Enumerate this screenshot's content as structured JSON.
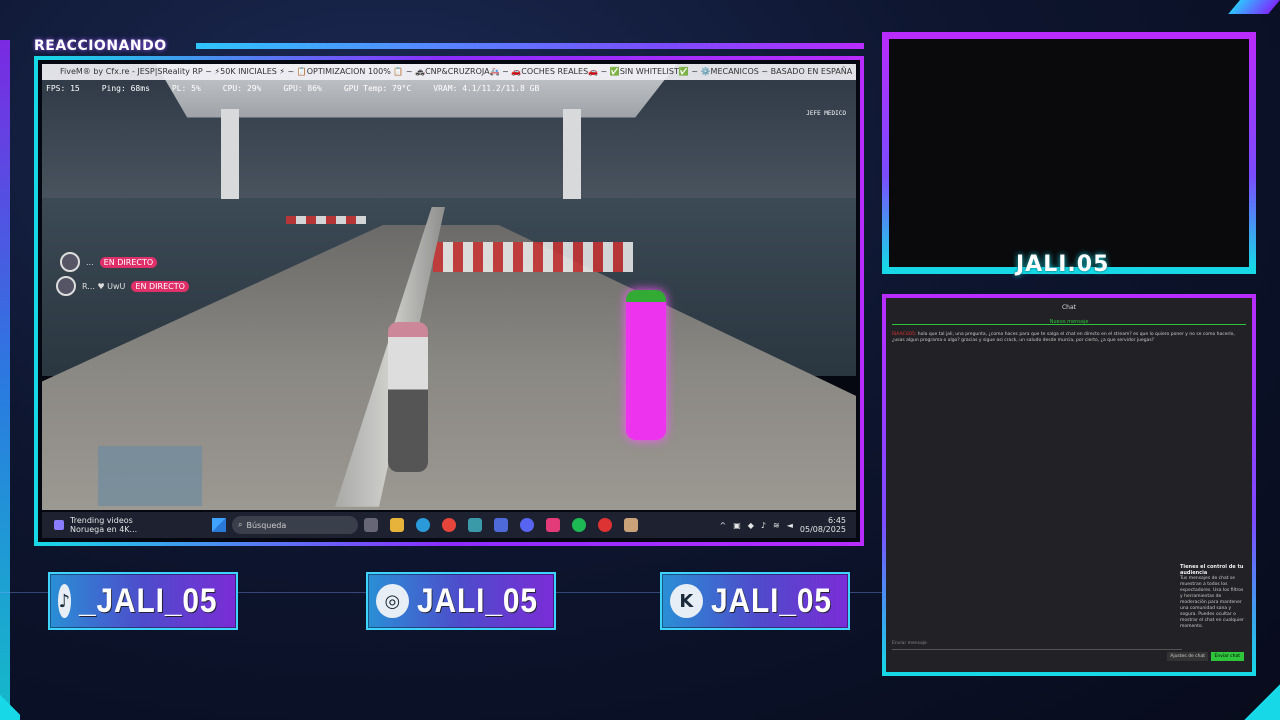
{
  "overlay": {
    "title": "REACCIONANDO",
    "cam_name": "JALI.05",
    "accent": "#8d2cff",
    "accent2": "#16d8e6"
  },
  "game_window": {
    "title": "FiveM® by Cfx.re - JESP|SReality RP ~ ⚡50K INICIALES ⚡ ~ 📋OPTIMIZACION 100% 📋 ~ 🚓CNP&CRUZROJA🚑 ~ 🚗COCHES REALES🚗 ~ ✅SIN WHITELIST✅ ~ ⚙️MECANICOS ~ BASADO EN ESPAÑA",
    "stats": {
      "fps": "FPS: 15",
      "ping": "Ping: 68ms",
      "pl": "PL: 5%",
      "cpu": "CPU: 29%",
      "gpu": "GPU: 86%",
      "gpu_temp": "GPU Temp: 79°C",
      "vram": "VRAM: 4.1/11.2/11.8 GB"
    },
    "live_rows": [
      {
        "name": "...",
        "badge": "EN DIRECTO"
      },
      {
        "name": "R... ♥ UwU",
        "badge": "EN DIRECTO"
      }
    ],
    "hud_top_right": "JEFE MEDICO"
  },
  "taskbar": {
    "widget_title": "Trending videos",
    "widget_sub": "Noruega en 4K...",
    "search_placeholder": "Búsqueda",
    "time": "6:45",
    "date": "05/08/2025"
  },
  "chat": {
    "header": "Chat",
    "subheader": "Nuevo mensaje",
    "message_user": "ISAACG05:",
    "message_text": "hola que tal jali, una pregunta, ¿como haces para que te salga el chat en directo en el stream? es que lo quiero poner y no se como hacerlo, ¿usas algun programa o algo? gracias y sigue asi crack, un saludo desde murcia, por cierto, ¿a que servidor juegas?",
    "notice_title": "Tienes el control de tu audiencia",
    "notice_text": "Tus mensajes de chat se muestran a todos los espectadores. Usa los filtros y herramientas de moderación para mantener una comunidad sana y segura. Puedes ocultar o mostrar el chat en cualquier momento.",
    "input_placeholder": "Enviar mensaje",
    "hide_button": "Ajustes de chat",
    "send_button": "Enviar chat"
  },
  "socials": [
    {
      "platform": "tiktok",
      "icon": "tiktok-icon",
      "glyph": "♪",
      "label": "_JALI_05"
    },
    {
      "platform": "instagram",
      "icon": "instagram-icon",
      "glyph": "◎",
      "label": "JALI_05"
    },
    {
      "platform": "kick",
      "icon": "kick-icon",
      "glyph": "K",
      "label": "JALI_05"
    }
  ]
}
